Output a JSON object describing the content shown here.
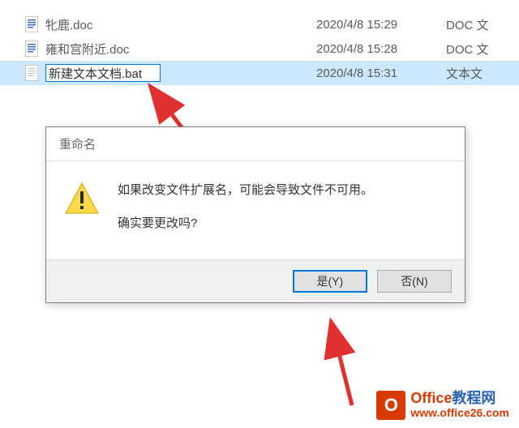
{
  "files": [
    {
      "name": "牝鹿.doc",
      "date": "2020/4/8 15:29",
      "type": "DOC 文"
    },
    {
      "name": "雍和宫附近.doc",
      "date": "2020/4/8 15:28",
      "type": "DOC 文"
    },
    {
      "name": "新建文本文档.bat",
      "date": "2020/4/8 15:31",
      "type": "文本文"
    }
  ],
  "dialog": {
    "title": "重命名",
    "line1": "如果改变文件扩展名，可能会导致文件不可用。",
    "line2": "确实要更改吗?",
    "yes": "是(Y)",
    "no": "否(N)"
  },
  "watermark": {
    "logo": "O",
    "title_red": "Office",
    "title_blue": "教程网",
    "url": "www.office26.com"
  }
}
